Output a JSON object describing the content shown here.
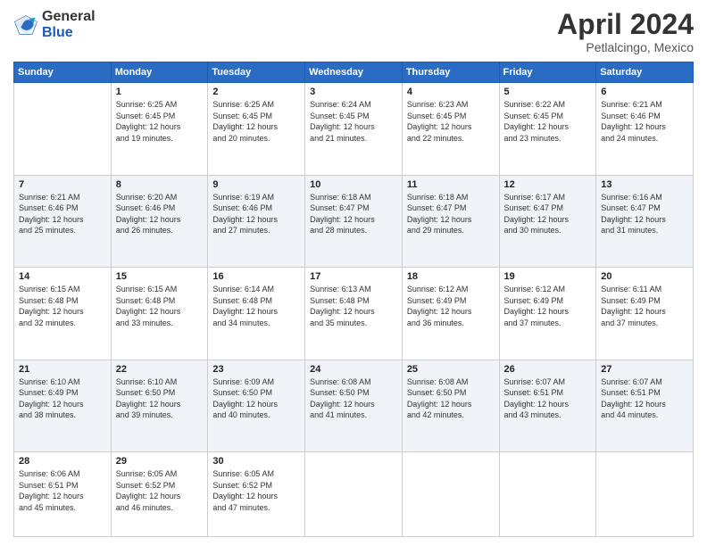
{
  "logo": {
    "general": "General",
    "blue": "Blue"
  },
  "title": {
    "month": "April 2024",
    "location": "Petlalcingo, Mexico"
  },
  "headers": [
    "Sunday",
    "Monday",
    "Tuesday",
    "Wednesday",
    "Thursday",
    "Friday",
    "Saturday"
  ],
  "weeks": [
    [
      {
        "num": "",
        "info": ""
      },
      {
        "num": "1",
        "info": "Sunrise: 6:25 AM\nSunset: 6:45 PM\nDaylight: 12 hours\nand 19 minutes."
      },
      {
        "num": "2",
        "info": "Sunrise: 6:25 AM\nSunset: 6:45 PM\nDaylight: 12 hours\nand 20 minutes."
      },
      {
        "num": "3",
        "info": "Sunrise: 6:24 AM\nSunset: 6:45 PM\nDaylight: 12 hours\nand 21 minutes."
      },
      {
        "num": "4",
        "info": "Sunrise: 6:23 AM\nSunset: 6:45 PM\nDaylight: 12 hours\nand 22 minutes."
      },
      {
        "num": "5",
        "info": "Sunrise: 6:22 AM\nSunset: 6:45 PM\nDaylight: 12 hours\nand 23 minutes."
      },
      {
        "num": "6",
        "info": "Sunrise: 6:21 AM\nSunset: 6:46 PM\nDaylight: 12 hours\nand 24 minutes."
      }
    ],
    [
      {
        "num": "7",
        "info": "Sunrise: 6:21 AM\nSunset: 6:46 PM\nDaylight: 12 hours\nand 25 minutes."
      },
      {
        "num": "8",
        "info": "Sunrise: 6:20 AM\nSunset: 6:46 PM\nDaylight: 12 hours\nand 26 minutes."
      },
      {
        "num": "9",
        "info": "Sunrise: 6:19 AM\nSunset: 6:46 PM\nDaylight: 12 hours\nand 27 minutes."
      },
      {
        "num": "10",
        "info": "Sunrise: 6:18 AM\nSunset: 6:47 PM\nDaylight: 12 hours\nand 28 minutes."
      },
      {
        "num": "11",
        "info": "Sunrise: 6:18 AM\nSunset: 6:47 PM\nDaylight: 12 hours\nand 29 minutes."
      },
      {
        "num": "12",
        "info": "Sunrise: 6:17 AM\nSunset: 6:47 PM\nDaylight: 12 hours\nand 30 minutes."
      },
      {
        "num": "13",
        "info": "Sunrise: 6:16 AM\nSunset: 6:47 PM\nDaylight: 12 hours\nand 31 minutes."
      }
    ],
    [
      {
        "num": "14",
        "info": "Sunrise: 6:15 AM\nSunset: 6:48 PM\nDaylight: 12 hours\nand 32 minutes."
      },
      {
        "num": "15",
        "info": "Sunrise: 6:15 AM\nSunset: 6:48 PM\nDaylight: 12 hours\nand 33 minutes."
      },
      {
        "num": "16",
        "info": "Sunrise: 6:14 AM\nSunset: 6:48 PM\nDaylight: 12 hours\nand 34 minutes."
      },
      {
        "num": "17",
        "info": "Sunrise: 6:13 AM\nSunset: 6:48 PM\nDaylight: 12 hours\nand 35 minutes."
      },
      {
        "num": "18",
        "info": "Sunrise: 6:12 AM\nSunset: 6:49 PM\nDaylight: 12 hours\nand 36 minutes."
      },
      {
        "num": "19",
        "info": "Sunrise: 6:12 AM\nSunset: 6:49 PM\nDaylight: 12 hours\nand 37 minutes."
      },
      {
        "num": "20",
        "info": "Sunrise: 6:11 AM\nSunset: 6:49 PM\nDaylight: 12 hours\nand 37 minutes."
      }
    ],
    [
      {
        "num": "21",
        "info": "Sunrise: 6:10 AM\nSunset: 6:49 PM\nDaylight: 12 hours\nand 38 minutes."
      },
      {
        "num": "22",
        "info": "Sunrise: 6:10 AM\nSunset: 6:50 PM\nDaylight: 12 hours\nand 39 minutes."
      },
      {
        "num": "23",
        "info": "Sunrise: 6:09 AM\nSunset: 6:50 PM\nDaylight: 12 hours\nand 40 minutes."
      },
      {
        "num": "24",
        "info": "Sunrise: 6:08 AM\nSunset: 6:50 PM\nDaylight: 12 hours\nand 41 minutes."
      },
      {
        "num": "25",
        "info": "Sunrise: 6:08 AM\nSunset: 6:50 PM\nDaylight: 12 hours\nand 42 minutes."
      },
      {
        "num": "26",
        "info": "Sunrise: 6:07 AM\nSunset: 6:51 PM\nDaylight: 12 hours\nand 43 minutes."
      },
      {
        "num": "27",
        "info": "Sunrise: 6:07 AM\nSunset: 6:51 PM\nDaylight: 12 hours\nand 44 minutes."
      }
    ],
    [
      {
        "num": "28",
        "info": "Sunrise: 6:06 AM\nSunset: 6:51 PM\nDaylight: 12 hours\nand 45 minutes."
      },
      {
        "num": "29",
        "info": "Sunrise: 6:05 AM\nSunset: 6:52 PM\nDaylight: 12 hours\nand 46 minutes."
      },
      {
        "num": "30",
        "info": "Sunrise: 6:05 AM\nSunset: 6:52 PM\nDaylight: 12 hours\nand 47 minutes."
      },
      {
        "num": "",
        "info": ""
      },
      {
        "num": "",
        "info": ""
      },
      {
        "num": "",
        "info": ""
      },
      {
        "num": "",
        "info": ""
      }
    ]
  ]
}
